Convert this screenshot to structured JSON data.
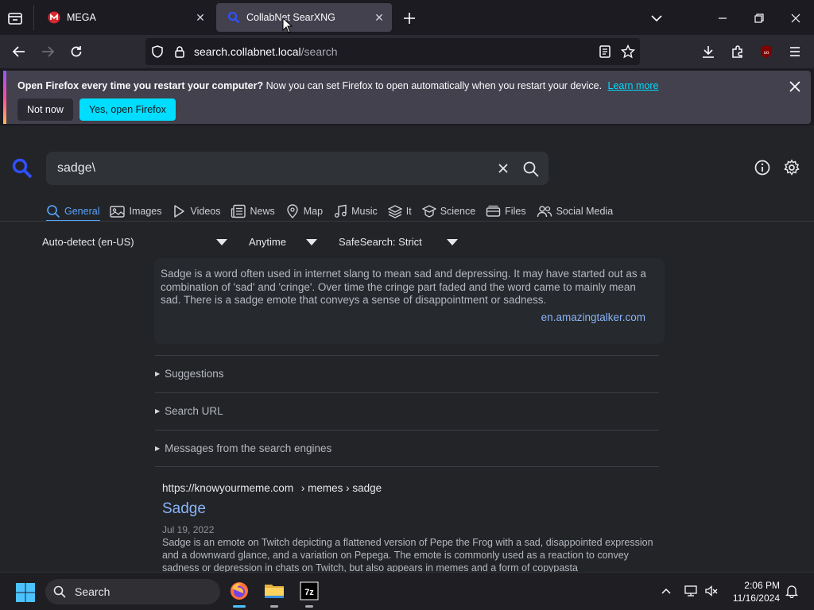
{
  "browser": {
    "tabs": [
      {
        "title": "MEGA",
        "active": false
      },
      {
        "title": "CollabNet SearXNG",
        "active": true
      }
    ],
    "url": {
      "host": "search.collabnet.local",
      "path": "/search"
    }
  },
  "notification": {
    "bold": "Open Firefox every time you restart your computer?",
    "text": "Now you can set Firefox to open automatically when you restart your device.",
    "link": "Learn more",
    "button_secondary": "Not now",
    "button_primary": "Yes, open Firefox"
  },
  "search": {
    "query": "sadge\\",
    "categories": [
      {
        "label": "General",
        "icon": "search-icon",
        "active": true
      },
      {
        "label": "Images",
        "icon": "image-icon"
      },
      {
        "label": "Videos",
        "icon": "play-icon"
      },
      {
        "label": "News",
        "icon": "newspaper-icon"
      },
      {
        "label": "Map",
        "icon": "map-pin-icon"
      },
      {
        "label": "Music",
        "icon": "music-icon"
      },
      {
        "label": "It",
        "icon": "layers-icon"
      },
      {
        "label": "Science",
        "icon": "graduation-cap-icon"
      },
      {
        "label": "Files",
        "icon": "files-icon"
      },
      {
        "label": "Social Media",
        "icon": "users-icon"
      }
    ],
    "filters": {
      "language": "Auto-detect (en-US)",
      "time": "Anytime",
      "safesearch": "SafeSearch: Strict"
    }
  },
  "infobox": {
    "text": "Sadge is a word often used in internet slang to mean sad and depressing. It may have started out as a combination of 'sad' and 'cringe'. Over time the cringe part faded and the word came to mainly mean sad. There is a sadge emote that conveys a sense of disappointment or sadness.",
    "source": "en.amazingtalker.com"
  },
  "sections": {
    "suggestions": "Suggestions",
    "search_url": "Search URL",
    "messages": "Messages from the search engines"
  },
  "result": {
    "url": "https://knowyourmeme.com",
    "breadcrumb": "› memes › sadge",
    "title": "Sadge",
    "date": "Jul 19, 2022",
    "content": "Sadge is an emote on Twitch depicting a flattened version of Pepe the Frog with a sad, disappointed expression and a downward glance, and a variation on Pepega. The emote is commonly used as a reaction to convey sadness or depression in chats on Twitch, but also appears in memes and a form of copypasta"
  },
  "taskbar": {
    "search_label": "Search",
    "time": "2:06 PM",
    "date": "11/16/2024"
  },
  "colors": {
    "accent_link": "#8ab4f8",
    "active_category": "#58a6ff",
    "primary_button": "#00ddff"
  }
}
